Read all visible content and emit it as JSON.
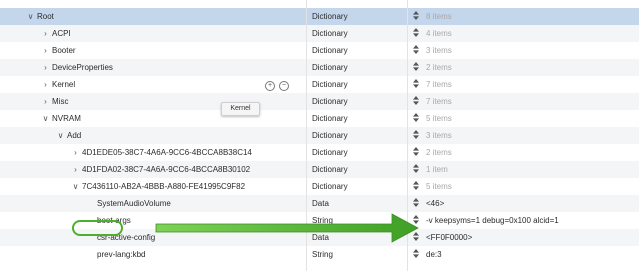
{
  "rows": [
    {
      "key": "Root",
      "type": "Dictionary",
      "value": "8 items",
      "dim": true,
      "disclosure": "expanded",
      "level": 0,
      "selected": true
    },
    {
      "key": "ACPI",
      "type": "Dictionary",
      "value": "4 items",
      "dim": true,
      "disclosure": "collapsed",
      "level": 1
    },
    {
      "key": "Booter",
      "type": "Dictionary",
      "value": "3 items",
      "dim": true,
      "disclosure": "collapsed",
      "level": 1
    },
    {
      "key": "DeviceProperties",
      "type": "Dictionary",
      "value": "2 items",
      "dim": true,
      "disclosure": "collapsed",
      "level": 1
    },
    {
      "key": "Kernel",
      "type": "Dictionary",
      "value": "7 items",
      "dim": true,
      "disclosure": "collapsed",
      "level": 1,
      "hover_buttons": true
    },
    {
      "key": "Misc",
      "type": "Dictionary",
      "value": "7 items",
      "dim": true,
      "disclosure": "collapsed",
      "level": 1
    },
    {
      "key": "NVRAM",
      "type": "Dictionary",
      "value": "5 items",
      "dim": true,
      "disclosure": "expanded",
      "level": 1
    },
    {
      "key": "Add",
      "type": "Dictionary",
      "value": "3 items",
      "dim": true,
      "disclosure": "expanded",
      "level": 2
    },
    {
      "key": "4D1EDE05-38C7-4A6A-9CC6-4BCCA8B38C14",
      "type": "Dictionary",
      "value": "2 items",
      "dim": true,
      "disclosure": "collapsed",
      "level": 3
    },
    {
      "key": "4D1FDA02-38C7-4A6A-9CC6-4BCCA8B30102",
      "type": "Dictionary",
      "value": "1 item",
      "dim": true,
      "disclosure": "collapsed",
      "level": 3
    },
    {
      "key": "7C436110-AB2A-4BBB-A880-FE41995C9F82",
      "type": "Dictionary",
      "value": "5 items",
      "dim": true,
      "disclosure": "expanded",
      "level": 3
    },
    {
      "key": "SystemAudioVolume",
      "type": "Data",
      "value": "<46>",
      "dim": false,
      "disclosure": "none",
      "level": 4
    },
    {
      "key": "boot-args",
      "type": "String",
      "value": "-v keepsyms=1 debug=0x100 alcid=1",
      "dim": false,
      "disclosure": "none",
      "level": 4,
      "highlighted": true
    },
    {
      "key": "csr-active-config",
      "type": "Data",
      "value": "<FF0F0000>",
      "dim": false,
      "disclosure": "none",
      "level": 4
    },
    {
      "key": "prev-lang:kbd",
      "type": "String",
      "value": "de:3",
      "dim": false,
      "disclosure": "none",
      "level": 4
    }
  ],
  "tooltip": {
    "text": "Kernel"
  },
  "colors": {
    "selection": "#c4d6ec",
    "highlight_green": "#4db02d",
    "alt_row": "#f4f5f7"
  }
}
